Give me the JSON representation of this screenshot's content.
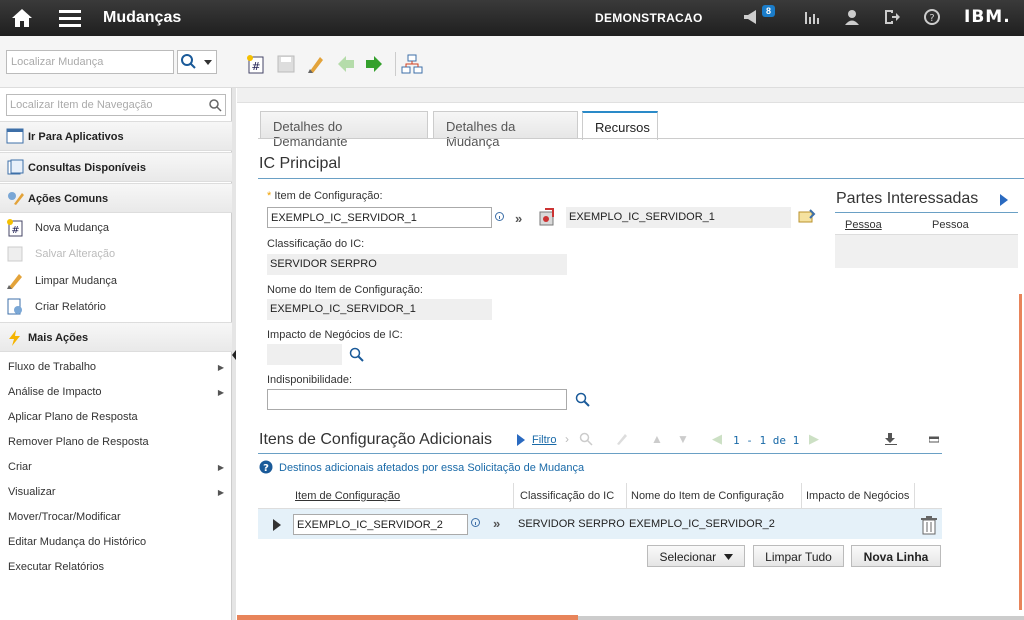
{
  "app": {
    "title": "Mudanças",
    "org": "DEMONSTRACAO",
    "notifications": "8",
    "brand": "IBM."
  },
  "toolbar": {
    "search_placeholder": "Localizar Mudança"
  },
  "sidebar": {
    "search_placeholder": "Localizar Item de Navegação",
    "go_to_apps": "Ir Para Aplicativos",
    "queries": "Consultas Disponíveis",
    "common_actions": "Ações Comuns",
    "actions": [
      "Nova Mudança",
      "Salvar Alteração",
      "Limpar Mudança",
      "Criar Relatório"
    ],
    "more_actions": "Mais Ações",
    "more_items": [
      {
        "label": "Fluxo de Trabalho",
        "submenu": true
      },
      {
        "label": "Análise de Impacto",
        "submenu": true
      },
      {
        "label": "Aplicar Plano de Resposta",
        "submenu": false
      },
      {
        "label": "Remover Plano de Resposta",
        "submenu": false
      },
      {
        "label": "Criar",
        "submenu": true
      },
      {
        "label": "Visualizar",
        "submenu": true
      },
      {
        "label": "Mover/Trocar/Modificar",
        "submenu": false
      },
      {
        "label": "Editar Mudança do Histórico",
        "submenu": false
      },
      {
        "label": "Executar Relatórios",
        "submenu": false
      }
    ]
  },
  "tabs": [
    "Detalhes do Demandante",
    "Detalhes da Mudança",
    "Recursos"
  ],
  "ic_principal": {
    "heading": "IC Principal",
    "ci_label": "Item de Configuração:",
    "ci_value": "EXEMPLO_IC_SERVIDOR_1",
    "ci_desc": "EXEMPLO_IC_SERVIDOR_1",
    "class_label": "Classificação do IC:",
    "class_value": "SERVIDOR SERPRO",
    "name_label": "Nome do Item de Configuração:",
    "name_value": "EXEMPLO_IC_SERVIDOR_1",
    "impact_label": "Impacto de Negócios de IC:",
    "impact_value": "",
    "unavail_label": "Indisponibilidade:",
    "unavail_value": ""
  },
  "stakeholders": {
    "heading": "Partes Interessadas",
    "col1": "Pessoa",
    "col2": "Pessoa"
  },
  "additional": {
    "heading": "Itens de Configuração Adicionais",
    "filter": "Filtro",
    "pager": "1 - 1 de 1",
    "help": "Destinos adicionais afetados por essa Solicitação de Mudança",
    "columns": [
      "Item de Configuração",
      "Classificação do IC",
      "Nome do Item de Configuração",
      "Impacto de Negócios"
    ],
    "row": {
      "ci": "EXEMPLO_IC_SERVIDOR_2",
      "class": "SERVIDOR SERPRO",
      "name": "EXEMPLO_IC_SERVIDOR_2",
      "impact": ""
    },
    "buttons": {
      "select": "Selecionar",
      "clear": "Limpar Tudo",
      "new_row": "Nova Linha"
    }
  }
}
